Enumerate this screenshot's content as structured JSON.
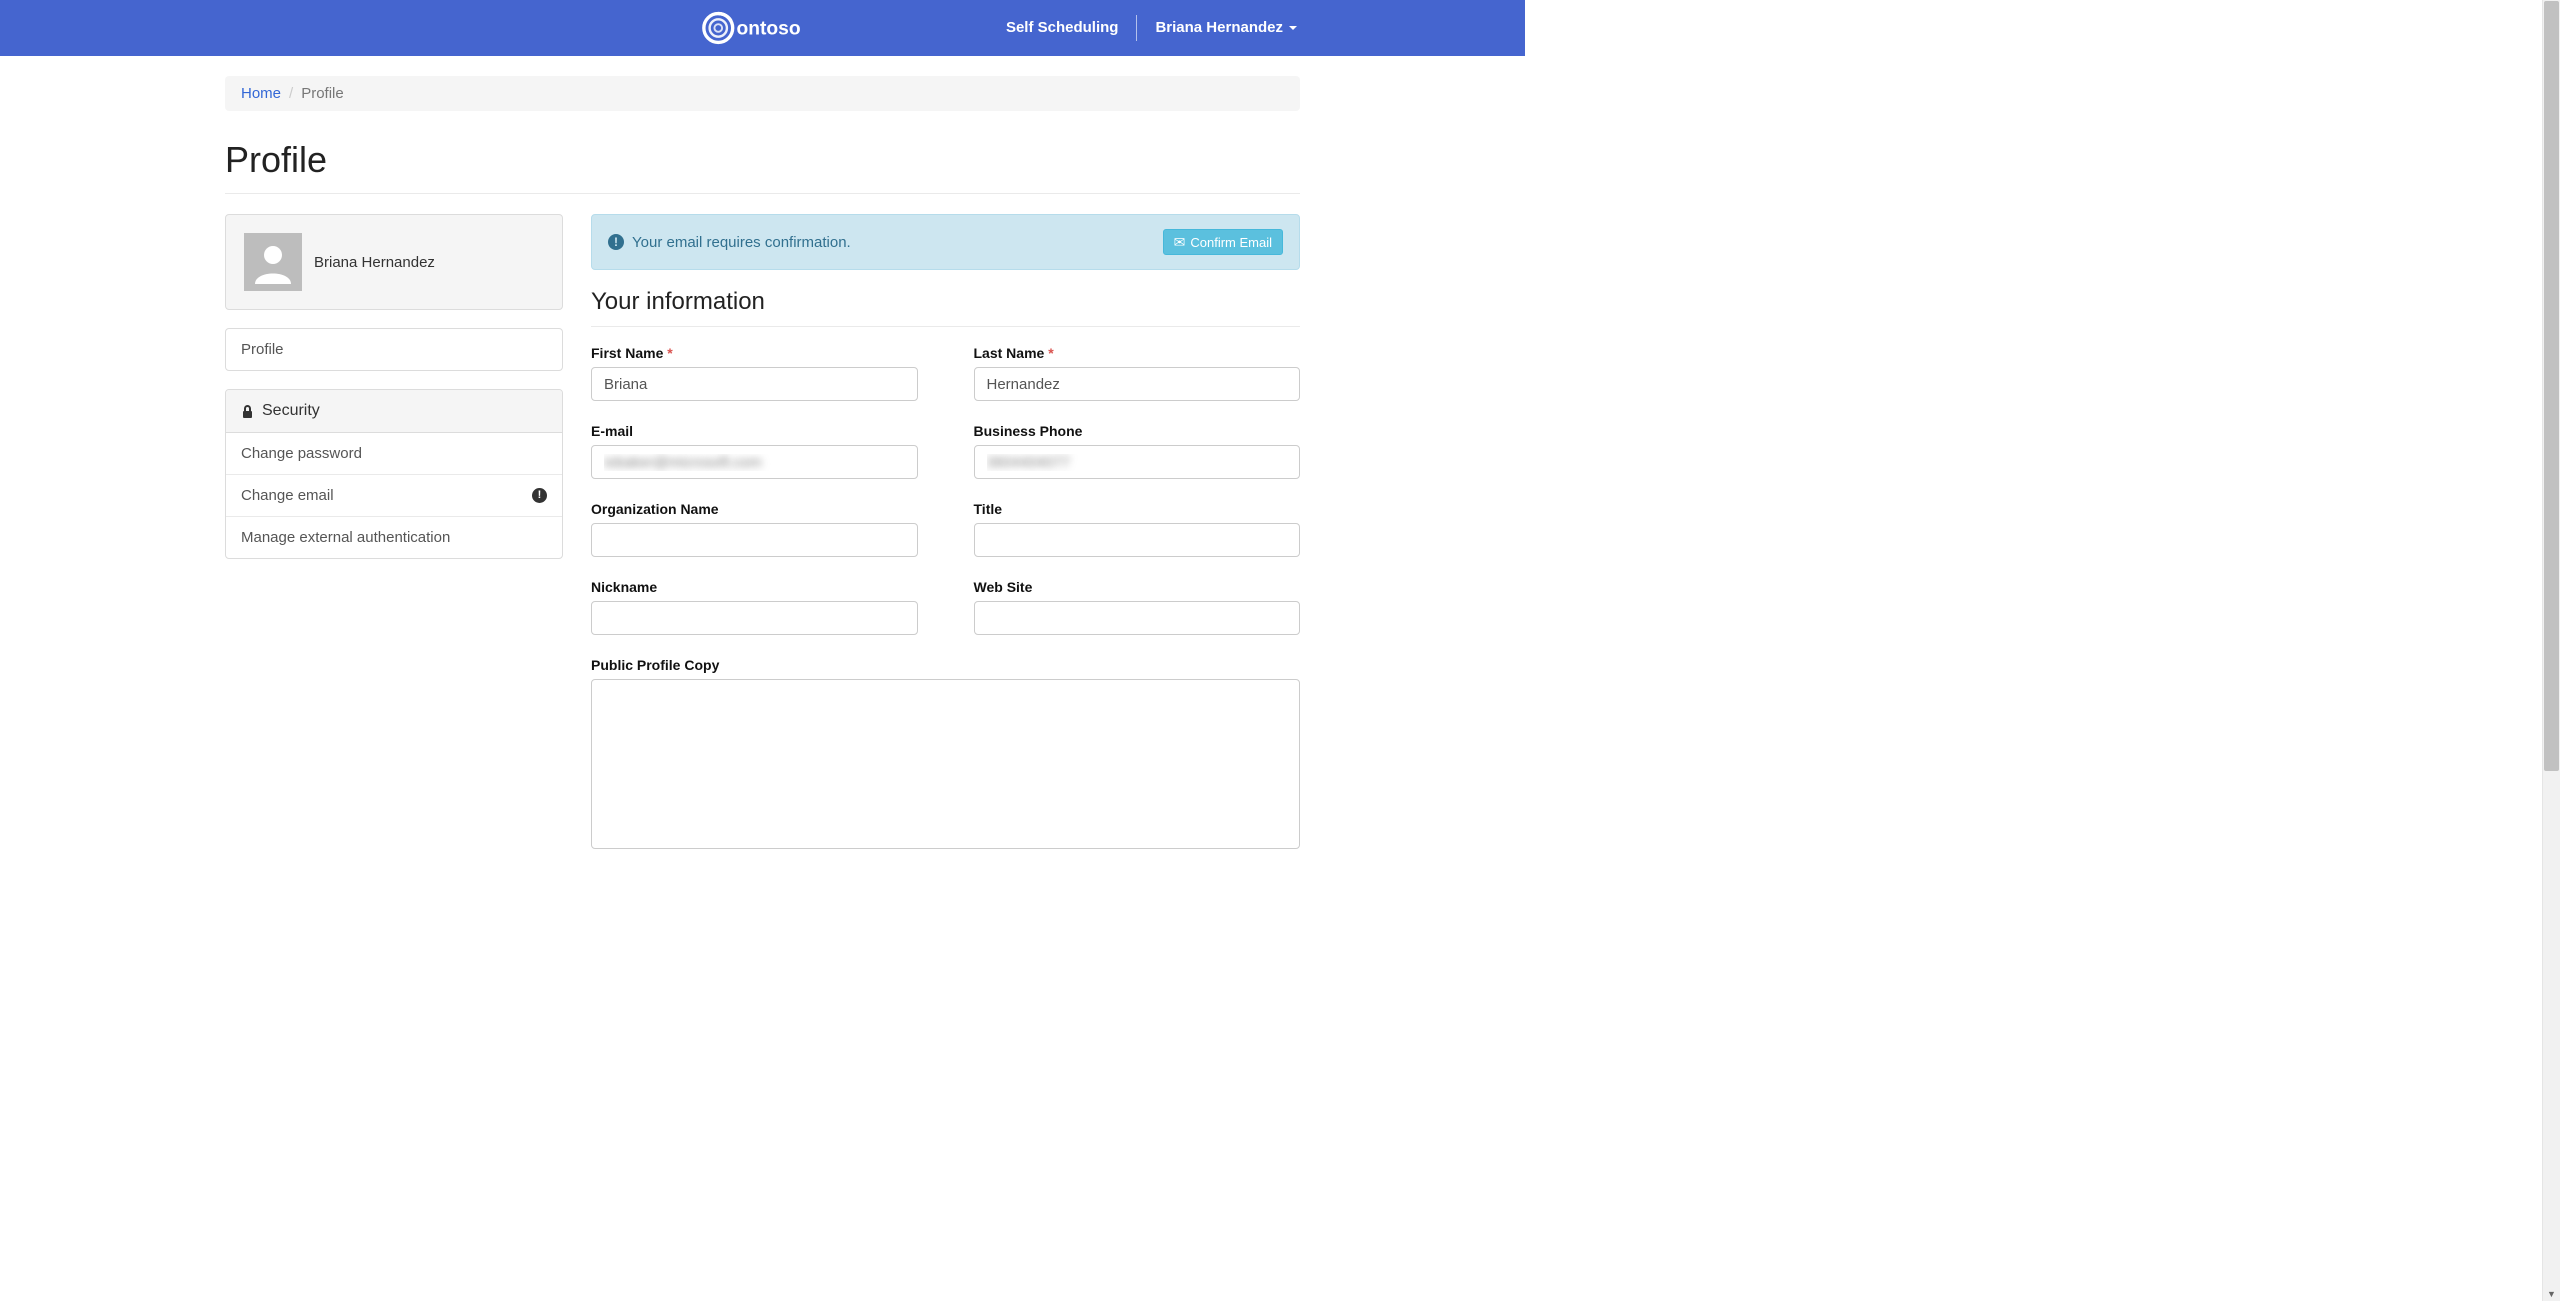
{
  "header": {
    "brand": "Contoso",
    "nav_self_scheduling": "Self Scheduling",
    "nav_user": "Briana Hernandez"
  },
  "breadcrumb": {
    "home": "Home",
    "current": "Profile"
  },
  "page_title": "Profile",
  "sidebar": {
    "display_name": "Briana Hernandez",
    "nav_profile": "Profile",
    "security_header": "Security",
    "security_items": [
      {
        "label": "Change password",
        "badge": false
      },
      {
        "label": "Change email",
        "badge": true
      },
      {
        "label": "Manage external authentication",
        "badge": false
      }
    ]
  },
  "alert": {
    "message": "Your email requires confirmation.",
    "button": "Confirm Email"
  },
  "form": {
    "section_title": "Your information",
    "fields": {
      "first_name": {
        "label": "First Name",
        "required": true,
        "value": "Briana"
      },
      "last_name": {
        "label": "Last Name",
        "required": true,
        "value": "Hernandez"
      },
      "email": {
        "label": "E-mail",
        "value": "iobaker@microsoft.com",
        "blurred": true
      },
      "business_phone": {
        "label": "Business Phone",
        "value": "3604404077",
        "blurred": true
      },
      "org_name": {
        "label": "Organization Name",
        "value": ""
      },
      "title": {
        "label": "Title",
        "value": ""
      },
      "nickname": {
        "label": "Nickname",
        "value": ""
      },
      "web_site": {
        "label": "Web Site",
        "value": ""
      },
      "public_profile_copy": {
        "label": "Public Profile Copy",
        "value": ""
      }
    }
  },
  "colors": {
    "header_bg": "#4565cf",
    "link": "#3367d6",
    "alert_bg": "#cde6f0",
    "alert_text": "#31708f",
    "btn_info": "#5bc0de",
    "required": "#d9534f"
  }
}
